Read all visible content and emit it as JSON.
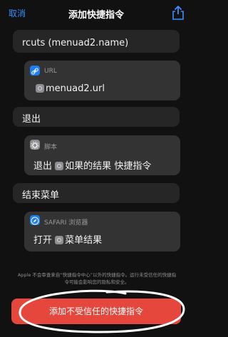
{
  "nav": {
    "cancel_label": "取消",
    "title": "添加快捷指令",
    "share_icon": "share-icon"
  },
  "actions": {
    "top_text": "rcuts (menuad2.name)",
    "url_action": {
      "label": "URL",
      "icon": "link-icon",
      "value": "menuad2.url"
    },
    "exit_block": {
      "label": "退出"
    },
    "script_action": {
      "label": "脚本",
      "icon": "gear-icon",
      "text_prefix": "退出",
      "text_token": "如果的结果",
      "text_suffix": "快捷指令"
    },
    "end_menu_block": {
      "label": "结束菜单"
    },
    "safari_action": {
      "label": "SAFARI 浏览器",
      "icon": "compass-icon",
      "text_prefix": "打开",
      "text_token": "菜单结果"
    }
  },
  "footer": {
    "note": "Apple 不会审查来自“快捷指令中心”以外的快捷指令。运行未受信任的快捷指令可能会影响您的隐私和安全。",
    "add_button_label": "添加不受信任的快捷指令"
  },
  "colors": {
    "accent_blue": "#3a8dff",
    "danger_red": "#e5473d",
    "background": "#111111"
  }
}
